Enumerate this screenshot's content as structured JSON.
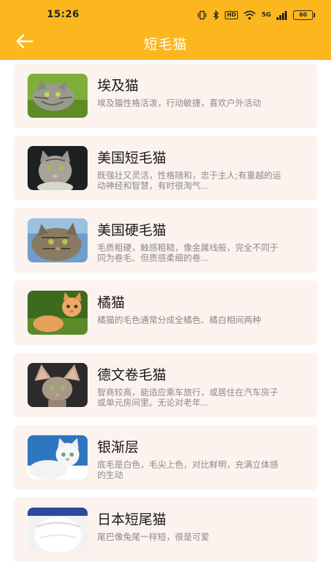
{
  "status_bar": {
    "time": "15:26",
    "network_badge": "HD",
    "signal_badge": "5G",
    "battery": "60"
  },
  "header": {
    "title": "短毛猫",
    "back_icon": "arrow-left-icon",
    "color": "#fcb61e"
  },
  "cats": [
    {
      "name": "埃及猫",
      "desc": "埃及猫性格活泼，行动敏捷，喜欢户外活动",
      "photo": "egyptian-cat-photo"
    },
    {
      "name": "美国短毛猫",
      "desc": "既强壮又灵活，性格随和，忠于主人;有重越的运动神经和智慧，有时很淘气...",
      "photo": "american-shorthair-photo"
    },
    {
      "name": "美国硬毛猫",
      "desc": "毛质粗硬，触感粗糙，像金属线般，完全不同于同为卷毛、但质感柔细的卷...",
      "photo": "american-wirehair-photo"
    },
    {
      "name": "橘猫",
      "desc": "  橘猫的毛色通常分成全橘色、橘白相间两种",
      "photo": "orange-cat-photo"
    },
    {
      "name": "德文卷毛猫",
      "desc": "智商较高，能适应乘车旅行，或居住在汽车房子或单元房间里。无论对老年...",
      "photo": "devon-rex-photo"
    },
    {
      "name": "银渐层",
      "desc": "底毛是白色，毛尖上色，对比鲜明，充满立体感的生动",
      "photo": "silver-shaded-photo"
    },
    {
      "name": "日本短尾猫",
      "desc": "尾巴像兔尾一样短，很是可爱",
      "photo": "japanese-bobtail-photo"
    }
  ]
}
